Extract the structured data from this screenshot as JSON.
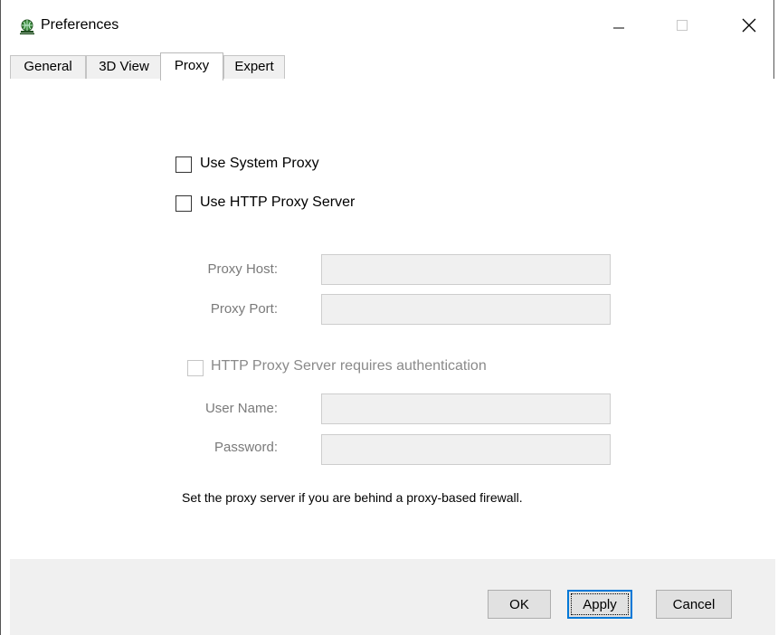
{
  "window": {
    "title": "Preferences",
    "app_icon": "globe-app-icon",
    "controls": [
      "minimize-icon",
      "maximize-icon",
      "close-icon"
    ]
  },
  "tabs": [
    {
      "label": "General",
      "active": false
    },
    {
      "label": "3D View",
      "active": false
    },
    {
      "label": "Proxy",
      "active": true
    },
    {
      "label": "Expert",
      "active": false
    }
  ],
  "proxy": {
    "use_system_proxy": {
      "label": "Use System Proxy",
      "checked": false
    },
    "use_http_proxy": {
      "label": "Use HTTP Proxy Server",
      "checked": false
    },
    "host": {
      "label": "Proxy Host:",
      "value": ""
    },
    "port": {
      "label": "Proxy Port:",
      "value": ""
    },
    "requires_auth": {
      "label": "HTTP Proxy Server requires authentication",
      "checked": false,
      "enabled": false
    },
    "username": {
      "label": "User Name:",
      "value": ""
    },
    "password": {
      "label": "Password:",
      "value": ""
    },
    "note": "Set the proxy server if you are behind a proxy-based firewall."
  },
  "buttons": {
    "ok": "OK",
    "apply": "Apply",
    "cancel": "Cancel"
  },
  "colors": {
    "focus_border": "#0078d7",
    "disabled_text": "#7a7a7a",
    "field_bg": "#f0f0f0"
  }
}
